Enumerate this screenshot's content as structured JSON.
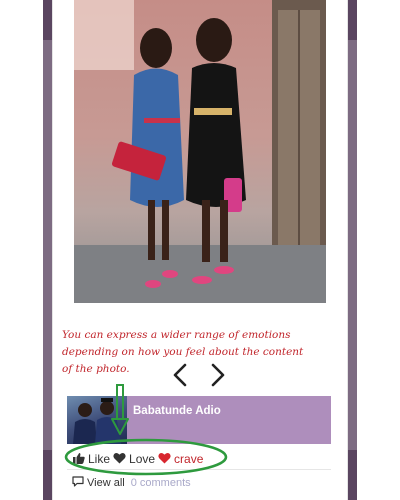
{
  "annotation": {
    "text": "You can express a wider range of emotions depending on how you feel about the content of the photo."
  },
  "post": {
    "author": "Babatunde Adio"
  },
  "reactions": {
    "like_label": "Like",
    "love_label": "Love",
    "crave_label": "crave"
  },
  "comments": {
    "view_all_label": "View all",
    "count_label": "0 comments"
  },
  "colors": {
    "accent": "#ae8ebc",
    "annotation_red": "#c1262c",
    "highlight_green": "#2e9a3e",
    "frame_purple": "#5a4560"
  },
  "icons": {
    "prev": "chevron-left-icon",
    "next": "chevron-right-icon",
    "like": "thumbs-up-icon",
    "love": "heart-icon",
    "crave": "heart-icon",
    "comments": "comment-bubble-icon",
    "pointer": "down-arrow-icon"
  }
}
